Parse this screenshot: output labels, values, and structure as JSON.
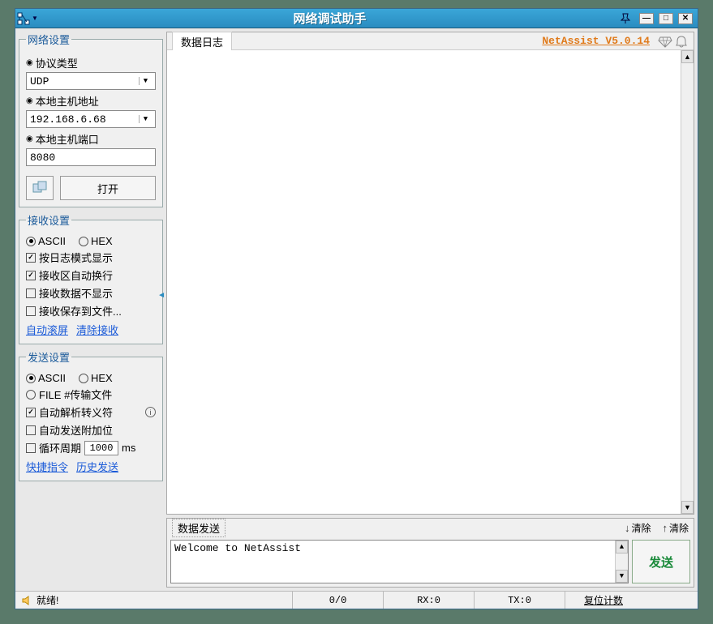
{
  "title": "网络调试助手",
  "version": "NetAssist V5.0.14",
  "network": {
    "legend": "网络设置",
    "protocol_label": "协议类型",
    "protocol_value": "UDP",
    "host_label": "本地主机地址",
    "host_value": "192.168.6.68",
    "port_label": "本地主机端口",
    "port_value": "8080",
    "open_btn": "打开"
  },
  "recv": {
    "legend": "接收设置",
    "ascii": "ASCII",
    "hex": "HEX",
    "log_mode": "按日志模式显示",
    "auto_wrap": "接收区自动换行",
    "hide_recv": "接收数据不显示",
    "save_file": "接收保存到文件...",
    "auto_scroll": "自动滚屏",
    "clear_recv": "清除接收"
  },
  "send": {
    "legend": "发送设置",
    "ascii": "ASCII",
    "hex": "HEX",
    "file": "FILE #传输文件",
    "auto_escape": "自动解析转义符",
    "auto_append": "自动发送附加位",
    "cycle_label_pre": "循环周期",
    "cycle_value": "1000",
    "cycle_unit": "ms",
    "quick_cmd": "快捷指令",
    "history": "历史发送"
  },
  "log_panel_title": "数据日志",
  "send_panel_title": "数据发送",
  "clear_label": "清除",
  "send_btn": "发送",
  "send_text": "Welcome to NetAssist",
  "status": {
    "ready": "就绪!",
    "ratio": "0/0",
    "rx": "RX:0",
    "tx": "TX:0",
    "reset": "复位计数"
  }
}
